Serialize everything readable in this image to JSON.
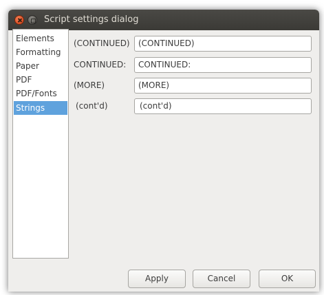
{
  "window": {
    "title": "Script settings dialog"
  },
  "sidebar": {
    "items": [
      {
        "label": "Elements"
      },
      {
        "label": "Formatting"
      },
      {
        "label": "Paper"
      },
      {
        "label": "PDF"
      },
      {
        "label": "PDF/Fonts"
      },
      {
        "label": "Strings"
      }
    ],
    "selected": "Strings",
    "selected_color": "#5fa2dd"
  },
  "strings": {
    "rows": [
      {
        "label": "(CONTINUED)",
        "value": "(CONTINUED)"
      },
      {
        "label": "CONTINUED:",
        "value": "CONTINUED:"
      },
      {
        "label": "(MORE)",
        "value": "(MORE)"
      },
      {
        "label": "(cont'd)",
        "value": "(cont'd)"
      }
    ]
  },
  "buttons": {
    "apply": "Apply",
    "cancel": "Cancel",
    "ok": "OK"
  }
}
